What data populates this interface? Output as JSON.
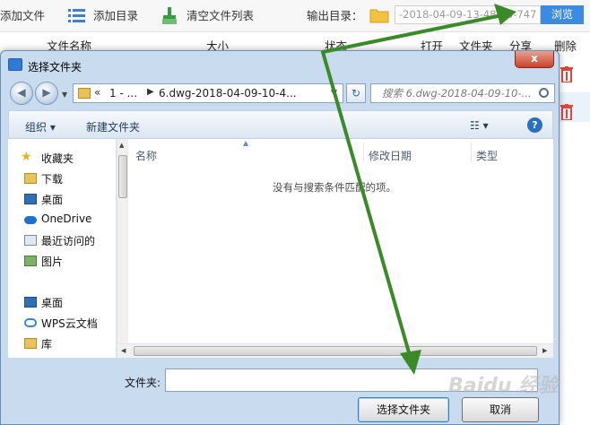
{
  "toolbar": {
    "add_file": "添加文件",
    "add_dir": "添加目录",
    "clear_list": "清空文件列表",
    "output_label": "输出目录：",
    "output_value": "-2018-04-09-13-48-55-747",
    "browse": "浏览"
  },
  "table_header": {
    "filename": "文件名称",
    "size": "大小",
    "status": "状态",
    "open": "打开",
    "folder": "文件夹",
    "share": "分享",
    "delete": "删除"
  },
  "dialog": {
    "title": "选择文件夹",
    "close": "x",
    "address": {
      "chevron": "«",
      "segment1": "1 - ...",
      "segment2": "6.dwg-2018-04-09-10-4..."
    },
    "search_placeholder": "搜索 6.dwg-2018-04-09-10-...",
    "commands": {
      "organize": "组织 ▾",
      "new_folder": "新建文件夹",
      "view": "☷ ▾",
      "help": "?"
    },
    "nav_items": [
      {
        "label": "收藏夹",
        "icon": "star-icon"
      },
      {
        "label": "下载",
        "icon": "download-folder-icon"
      },
      {
        "label": "桌面",
        "icon": "desktop-icon"
      },
      {
        "label": "OneDrive",
        "icon": "cloud-icon"
      },
      {
        "label": "最近访问的",
        "icon": "recent-icon"
      },
      {
        "label": "图片",
        "icon": "pictures-icon"
      },
      {
        "label": "桌面",
        "icon": "desktop-icon"
      },
      {
        "label": "WPS云文档",
        "icon": "wps-cloud-icon"
      },
      {
        "label": "库",
        "icon": "library-icon"
      }
    ],
    "columns": {
      "name": "名称",
      "modified": "修改日期",
      "type": "类型"
    },
    "empty_message": "没有与搜索条件匹配的项。",
    "folder_label": "文件夹:",
    "folder_value": "",
    "select_button": "选择文件夹",
    "cancel_button": "取消"
  },
  "watermark": "Baidu 经验",
  "colors": {
    "accent": "#3b8be0",
    "annotation_arrow": "#3a8a2a",
    "delete_icon": "#e0463a"
  }
}
